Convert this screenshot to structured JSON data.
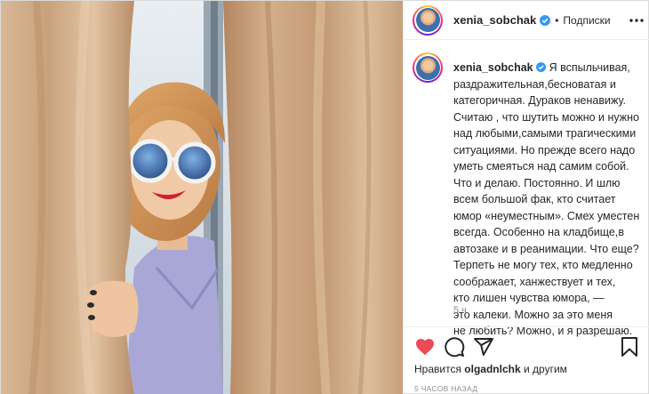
{
  "header": {
    "username": "xenia_sobchak",
    "separator": "•",
    "follow_label": "Подписки",
    "more_icon": "more-horizontal-icon"
  },
  "caption": {
    "username": "xenia_sobchak",
    "lines": [
      "Я вспыльчивая,",
      "раздражительная,бесноватая и",
      "категоричная. Дураков ненавижу.",
      "Считаю , что шутить можно и нужно",
      "над любыми,самыми трагическими",
      "ситуациями. Но прежде всего надо",
      "уметь смеяться над самим собой.",
      "Что и делаю. Постоянно. И шлю",
      "всем большой фак, кто считает",
      "юмор «неуместным». Смех уместен",
      "всегда. Особенно на кладбище,в",
      "автозаке и в реанимации. Что еще?",
      "Терпеть не могу тех, кто медленно",
      "соображает, ханжествует и тех,",
      "кто лишен чувства юмора, —",
      "это калеки. Можно за это меня",
      "не любить? Можно, и я разрешаю."
    ],
    "time": "5 ч."
  },
  "actions": {
    "like_icon": "heart-filled-icon",
    "comment_icon": "comment-icon",
    "share_icon": "share-icon",
    "save_icon": "bookmark-icon",
    "like_color": "#ed4956"
  },
  "likes": {
    "prefix": "Нравится",
    "user": "olgadnlchk",
    "suffix": "и другим"
  },
  "posted_ago": "5 ЧАСОВ НАЗАД",
  "colors": {
    "verified": "#3897f0",
    "muted": "#8e8e8e",
    "text": "#262626"
  }
}
